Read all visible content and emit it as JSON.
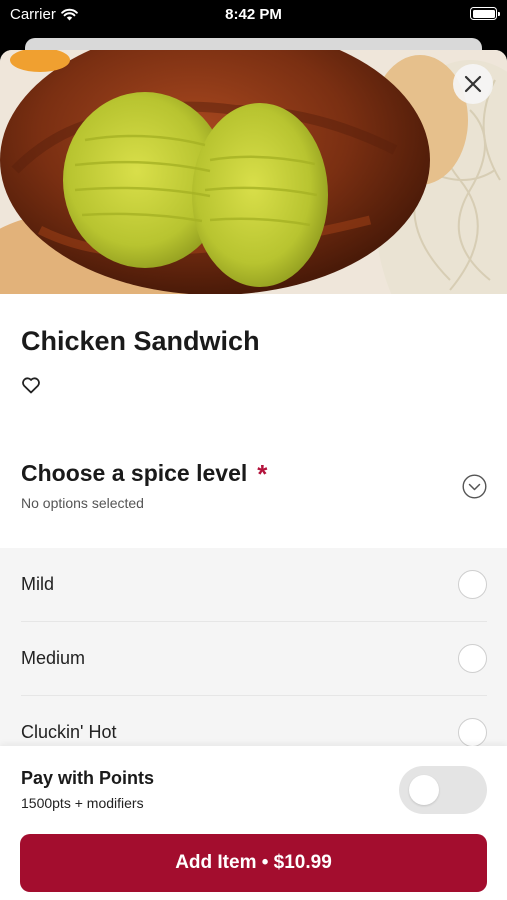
{
  "status_bar": {
    "carrier": "Carrier",
    "time": "8:42 PM",
    "icons": [
      "wifi-icon",
      "battery-icon"
    ]
  },
  "item": {
    "image": "chicken-sandwich-photo",
    "title": "Chicken Sandwich",
    "favorite_icon": "heart-outline-icon",
    "close_icon": "close-icon"
  },
  "spice": {
    "title": "Choose a spice level",
    "required_marker": "*",
    "subtitle": "No options selected",
    "expand_icon": "chevron-down-circle-icon",
    "options": [
      {
        "label": "Mild",
        "selected": false
      },
      {
        "label": "Medium",
        "selected": false
      },
      {
        "label": "Cluckin' Hot",
        "selected": false
      }
    ]
  },
  "points": {
    "title": "Pay with Points",
    "subtitle": "1500pts + modifiers",
    "enabled": false
  },
  "cta": {
    "label": "Add Item • $10.99"
  },
  "colors": {
    "accent": "#a30d2e",
    "required": "#b3123b",
    "options_bg": "#f5f5f5"
  }
}
